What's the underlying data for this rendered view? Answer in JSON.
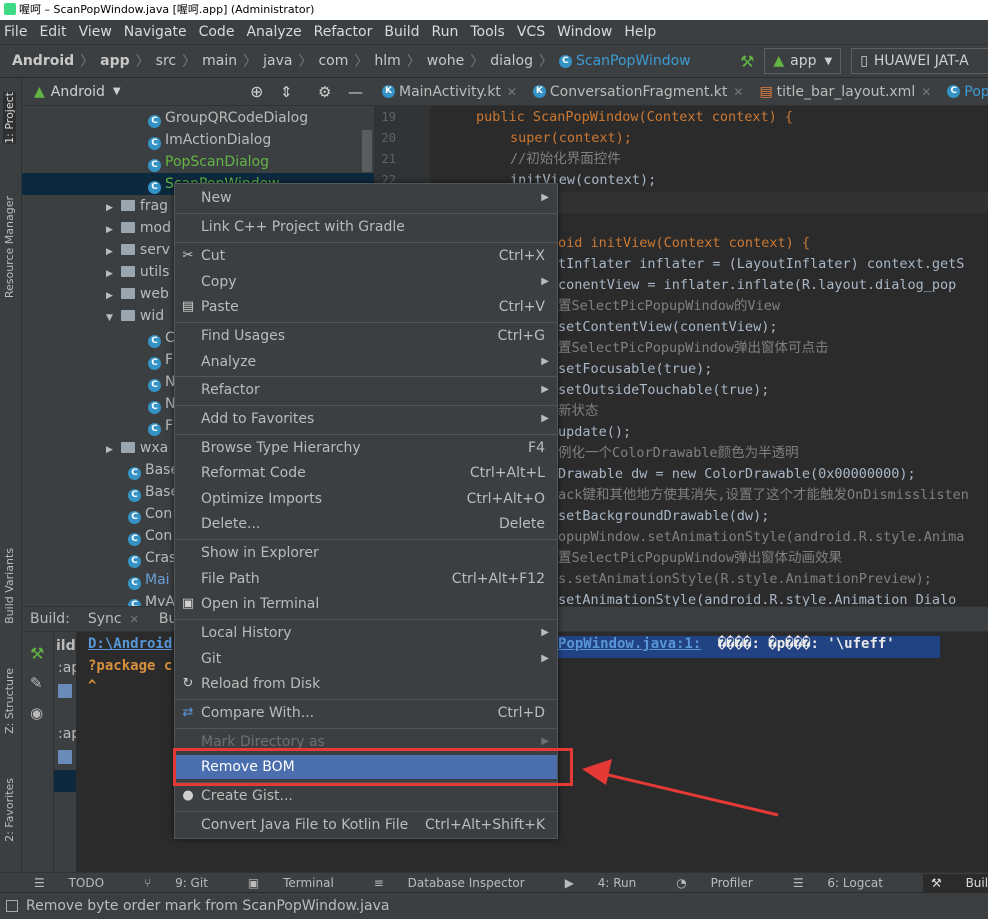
{
  "window": {
    "title": "喔呵 – ScanPopWindow.java [喔呵.app] (Administrator)"
  },
  "menubar": [
    "File",
    "Edit",
    "View",
    "Navigate",
    "Code",
    "Analyze",
    "Refactor",
    "Build",
    "Run",
    "Tools",
    "VCS",
    "Window",
    "Help"
  ],
  "breadcrumb": [
    "Android",
    "app",
    "src",
    "main",
    "java",
    "com",
    "hlm",
    "wohe",
    "dialog",
    "ScanPopWindow"
  ],
  "run_config": {
    "module": "app",
    "device": "HUAWEI JAT-A"
  },
  "project_panel": {
    "view": "Android",
    "items": [
      {
        "label": "GroupQRCodeDialog"
      },
      {
        "label": "ImActionDialog"
      },
      {
        "label": "PopScanDialog"
      },
      {
        "label": "ScanPopWindow"
      },
      {
        "label": "frag"
      },
      {
        "label": "mod"
      },
      {
        "label": "serv"
      },
      {
        "label": "utils"
      },
      {
        "label": "web"
      },
      {
        "label": "wid"
      },
      {
        "label": "C"
      },
      {
        "label": "F"
      },
      {
        "label": "N"
      },
      {
        "label": "N"
      },
      {
        "label": "F"
      },
      {
        "label": "wxa"
      },
      {
        "label": "Base"
      },
      {
        "label": "Base"
      },
      {
        "label": "Con"
      },
      {
        "label": "Con"
      },
      {
        "label": "Cras"
      },
      {
        "label": "Mai"
      },
      {
        "label": "MyA"
      }
    ]
  },
  "editor_tabs": [
    {
      "label": "MainActivity.kt"
    },
    {
      "label": "ConversationFragment.kt"
    },
    {
      "label": "title_bar_layout.xml"
    },
    {
      "label": "Pop"
    }
  ],
  "code": {
    "lines": [
      "19",
      "20",
      "21",
      "22"
    ],
    "text": [
      "public ScanPopWindow(Context context) {",
      "super(context);",
      "//初始化界面控件",
      "initView(context);",
      "oid initView(Context context) {",
      "tInflater inflater = (LayoutInflater) context.getS",
      "conentView = inflater.inflate(R.layout.dialog_pop",
      "置SelectPicPopupWindow的View",
      "setContentView(conentView);",
      "置SelectPicPopupWindow弹出窗体可点击",
      "setFocusable(true);",
      "setOutsideTouchable(true);",
      "新状态",
      "update();",
      "例化一个ColorDrawable颜色为半透明",
      "Drawable dw = new ColorDrawable(0x00000000);",
      "ack键和其他地方使其消失,设置了这个才能触发OnDismisslisten",
      "setBackgroundDrawable(dw);",
      "opupWindow.setAnimationStyle(android.R.style.Anima",
      "置SelectPicPopupWindow弹出窗体动画效果",
      "s.setAnimationStyle(R.style.AnimationPreview);",
      "setAnimationStyle(android.R.style.Animation_Dialo"
    ]
  },
  "build_panel": {
    "label": "Build:",
    "tabs": [
      "Sync",
      "Bu"
    ],
    "tree": [
      "ild",
      ":ap",
      ":ap"
    ],
    "output_path": "D:\\Android",
    "output_error_link": "PopWindow.java:1:",
    "output_error_msg": "����: �p���: '\\ufeff'",
    "output_line2": "?package c",
    "output_line3": "^"
  },
  "context_menu": {
    "items": [
      {
        "label": "New",
        "shortcut": "",
        "submenu": true,
        "icon": ""
      },
      {
        "label": "Link C++ Project with Gradle",
        "shortcut": "",
        "submenu": false,
        "icon": ""
      },
      {
        "label": "Cut",
        "shortcut": "Ctrl+X",
        "submenu": false,
        "icon": "✂"
      },
      {
        "label": "Copy",
        "shortcut": "",
        "submenu": true,
        "icon": ""
      },
      {
        "label": "Paste",
        "shortcut": "Ctrl+V",
        "submenu": false,
        "icon": "📋"
      },
      {
        "label": "Find Usages",
        "shortcut": "Ctrl+G",
        "submenu": false,
        "icon": ""
      },
      {
        "label": "Analyze",
        "shortcut": "",
        "submenu": true,
        "icon": ""
      },
      {
        "label": "Refactor",
        "shortcut": "",
        "submenu": true,
        "icon": ""
      },
      {
        "label": "Add to Favorites",
        "shortcut": "",
        "submenu": true,
        "icon": ""
      },
      {
        "label": "Browse Type Hierarchy",
        "shortcut": "F4",
        "submenu": false,
        "icon": ""
      },
      {
        "label": "Reformat Code",
        "shortcut": "Ctrl+Alt+L",
        "submenu": false,
        "icon": ""
      },
      {
        "label": "Optimize Imports",
        "shortcut": "Ctrl+Alt+O",
        "submenu": false,
        "icon": ""
      },
      {
        "label": "Delete...",
        "shortcut": "Delete",
        "submenu": false,
        "icon": ""
      },
      {
        "label": "Show in Explorer",
        "shortcut": "",
        "submenu": false,
        "icon": ""
      },
      {
        "label": "File Path",
        "shortcut": "Ctrl+Alt+F12",
        "submenu": false,
        "icon": ""
      },
      {
        "label": "Open in Terminal",
        "shortcut": "",
        "submenu": false,
        "icon": "▣"
      },
      {
        "label": "Local History",
        "shortcut": "",
        "submenu": true,
        "icon": ""
      },
      {
        "label": "Git",
        "shortcut": "",
        "submenu": true,
        "icon": ""
      },
      {
        "label": "Reload from Disk",
        "shortcut": "",
        "submenu": false,
        "icon": "↻"
      },
      {
        "label": "Compare With...",
        "shortcut": "Ctrl+D",
        "submenu": false,
        "icon": "⇄"
      },
      {
        "label": "Mark Directory as",
        "shortcut": "",
        "submenu": true,
        "icon": "",
        "disabled": true
      },
      {
        "label": "Remove BOM",
        "shortcut": "",
        "submenu": false,
        "icon": "",
        "selected": true
      },
      {
        "label": "Create Gist...",
        "shortcut": "",
        "submenu": false,
        "icon": "●"
      },
      {
        "label": "Convert Java File to Kotlin File",
        "shortcut": "Ctrl+Alt+Shift+K",
        "submenu": false,
        "icon": ""
      }
    ]
  },
  "left_strip": [
    "1: Project",
    "Resource Manager",
    "Build Variants",
    "Z: Structure",
    "2: Favorites"
  ],
  "bottom_tools": [
    "TODO",
    "9: Git",
    "Terminal",
    "Database Inspector",
    "4: Run",
    "Profiler",
    "6: Logcat",
    "Build"
  ],
  "status_bar": {
    "message": "Remove byte order mark from ScanPopWindow.java"
  },
  "colors": {
    "accent": "#4b6eaf",
    "annotation": "#e53935"
  }
}
